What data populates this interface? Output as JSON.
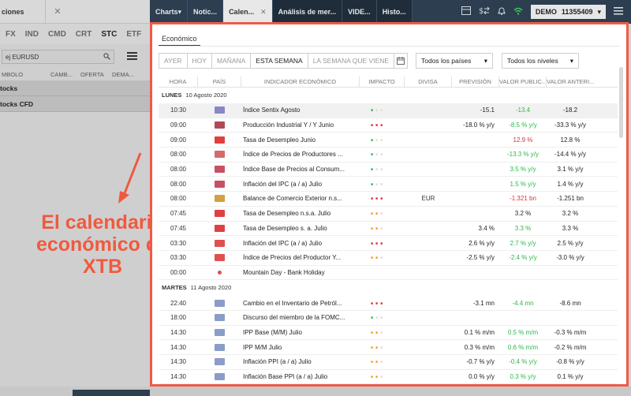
{
  "left": {
    "title": "ciones",
    "close_glyph": "✕",
    "tabs": [
      "FX",
      "IND",
      "CMD",
      "CRT",
      "STC",
      "ETF"
    ],
    "active_tab": "STC",
    "search_placeholder": "ej EURUSD",
    "columns": [
      "MBOLO",
      "CAMB...",
      "OFERTA",
      "DEMA..."
    ],
    "groups": [
      "tocks",
      "tocks CFD"
    ]
  },
  "annotation": {
    "line1": "El calendario",
    "line2": "económico de XTB",
    "color": "#f0593e"
  },
  "topbar": {
    "tabs": [
      {
        "label": "Charts",
        "suffix": "▾"
      },
      {
        "label": "Notic..."
      },
      {
        "label": "Calen...",
        "close": "✕"
      },
      {
        "label": "Análisis de mer..."
      },
      {
        "label": "VIDE..."
      },
      {
        "label": "Histo..."
      }
    ],
    "account_label": "DEMO",
    "account_number": "11355409",
    "account_arrow": "▾"
  },
  "main": {
    "tab_label": "Económico",
    "filter_buttons": [
      "AYER",
      "HOY",
      "MAÑANA",
      "ESTA SEMANA",
      "LA SEMANA QUE VIENE"
    ],
    "active_filter": "ESTA SEMANA",
    "country_select": "Todos los países",
    "level_select": "Todos los niveles",
    "select_arrow": "▾",
    "headers": [
      "HORA",
      "PAÍS",
      "INDICADOR ECONÓMICO",
      "IMPACTO",
      "DIVISA",
      "PREVISIÓN",
      "VALOR PUBLIC...",
      "VALOR ANTERI..."
    ],
    "days": [
      {
        "label": "LUNES",
        "date": "10 Agosto 2020",
        "rows": [
          {
            "time": "10:30",
            "flag": "#8a86c8",
            "indicator": "Índice Sentix Agosto",
            "impact": "low",
            "currency": "",
            "forecast": "-15.1",
            "actual": "-13.4",
            "actual_color": "pos",
            "previous": "-18.2",
            "hl": true
          },
          {
            "time": "09:00",
            "flag": "#b04a5a",
            "indicator": "Producción Industrial Y / Y Junio",
            "impact": "high",
            "currency": "",
            "forecast": "-18.0 % y/y",
            "actual": "-8.5 % y/y",
            "actual_color": "pos",
            "previous": "-33.3 % y/y"
          },
          {
            "time": "09:00",
            "flag": "#e04040",
            "indicator": "Tasa de Desempleo Junio",
            "impact": "low",
            "currency": "",
            "forecast": "",
            "actual": "12.9 %",
            "actual_color": "neg",
            "previous": "12.8 %"
          },
          {
            "time": "08:00",
            "flag": "#d66a6a",
            "indicator": "Índice de Precios de Productores ...",
            "impact": "low",
            "currency": "",
            "forecast": "",
            "actual": "-13.3 % y/y",
            "actual_color": "pos",
            "previous": "-14.4 % y/y"
          },
          {
            "time": "08:00",
            "flag": "#c85060",
            "indicator": "Índice Base de Precios al Consum...",
            "impact": "low",
            "currency": "",
            "forecast": "",
            "actual": "3.5 % y/y",
            "actual_color": "pos",
            "previous": "3.1 % y/y"
          },
          {
            "time": "08:00",
            "flag": "#c85060",
            "indicator": "Inflación del IPC (a / a) Julio",
            "impact": "low",
            "currency": "",
            "forecast": "",
            "actual": "1.5 % y/y",
            "actual_color": "pos",
            "previous": "1.4 % y/y"
          },
          {
            "time": "08:00",
            "flag": "#d4a040",
            "indicator": "Balance de Comercio Exterior n.s...",
            "impact": "high",
            "currency": "EUR",
            "forecast": "",
            "actual": "-1.321 bn",
            "actual_color": "neg",
            "previous": "-1.251 bn"
          },
          {
            "time": "07:45",
            "flag": "#e04040",
            "indicator": "Tasa de Desempleo n.s.a. Julio",
            "impact": "med",
            "currency": "",
            "forecast": "",
            "actual": "3.2 %",
            "actual_color": "",
            "previous": "3.2 %"
          },
          {
            "time": "07:45",
            "flag": "#e04040",
            "indicator": "Tasa de Desempleo s. a. Julio",
            "impact": "med",
            "currency": "",
            "forecast": "3.4 %",
            "actual": "3.3 %",
            "actual_color": "pos",
            "previous": "3.3 %"
          },
          {
            "time": "03:30",
            "flag": "#e05050",
            "indicator": "Inflación del IPC (a / a) Julio",
            "impact": "high",
            "currency": "",
            "forecast": "2.6 % y/y",
            "actual": "2.7 % y/y",
            "actual_color": "pos",
            "previous": "2.5 % y/y"
          },
          {
            "time": "03:30",
            "flag": "#e05050",
            "indicator": "Índice de Precios del Productor Y...",
            "impact": "med",
            "currency": "",
            "forecast": "-2.5 % y/y",
            "actual": "-2.4 % y/y",
            "actual_color": "pos",
            "previous": "-3.0 % y/y"
          },
          {
            "time": "00:00",
            "flag": "dot",
            "indicator": "Mountain Day - Bank Holiday",
            "impact": "",
            "currency": "",
            "forecast": "",
            "actual": "",
            "actual_color": "",
            "previous": ""
          }
        ]
      },
      {
        "label": "MARTES",
        "date": "11 Agosto 2020",
        "rows": [
          {
            "time": "22:40",
            "flag": "#8a9cc8",
            "indicator": "Cambio en el Inventario de Petról...",
            "impact": "high",
            "currency": "",
            "forecast": "-3.1 mn",
            "actual": "-4.4 mn",
            "actual_color": "pos",
            "previous": "-8.6 mn"
          },
          {
            "time": "18:00",
            "flag": "#8a9cc8",
            "indicator": "Discurso del miembro de la FOMC...",
            "impact": "low",
            "currency": "",
            "forecast": "",
            "actual": "",
            "actual_color": "",
            "previous": ""
          },
          {
            "time": "14:30",
            "flag": "#8a9cc8",
            "indicator": "IPP Base (M/M) Julio",
            "impact": "med",
            "currency": "",
            "forecast": "0.1 % m/m",
            "actual": "0.5 % m/m",
            "actual_color": "pos",
            "previous": "-0.3 % m/m"
          },
          {
            "time": "14:30",
            "flag": "#8a9cc8",
            "indicator": "IPP M/M Julio",
            "impact": "med",
            "currency": "",
            "forecast": "0.3 % m/m",
            "actual": "0.6 % m/m",
            "actual_color": "pos",
            "previous": "-0.2 % m/m"
          },
          {
            "time": "14:30",
            "flag": "#8a9cc8",
            "indicator": "Inflación PPI (a / a) Julio",
            "impact": "med",
            "currency": "",
            "forecast": "-0.7 % y/y",
            "actual": "-0.4 % y/y",
            "actual_color": "pos",
            "previous": "-0.8 % y/y"
          },
          {
            "time": "14:30",
            "flag": "#8a9cc8",
            "indicator": "Inflación Base PPI (a / a) Julio",
            "impact": "med",
            "currency": "",
            "forecast": "0.0 % y/y",
            "actual": "0.3 % y/y",
            "actual_color": "pos",
            "previous": "0.1 % y/y"
          }
        ]
      }
    ]
  }
}
